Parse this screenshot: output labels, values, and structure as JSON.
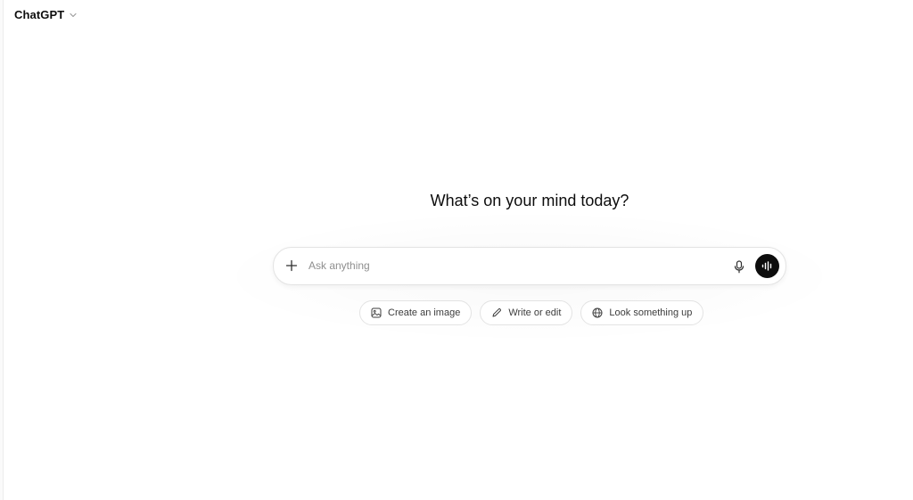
{
  "header": {
    "model_name": "ChatGPT",
    "chevron_icon": "chevron-down-icon"
  },
  "main": {
    "heading": "What’s on your mind today?"
  },
  "composer": {
    "placeholder": "Ask anything",
    "value": "",
    "plus_icon": "plus-icon",
    "mic_icon": "microphone-icon",
    "voice_icon": "voice-waveform-icon",
    "voice_button_color": "#0d0d0d"
  },
  "suggestions": [
    {
      "label": "Create an image",
      "icon": "image-icon"
    },
    {
      "label": "Write or edit",
      "icon": "pencil-icon"
    },
    {
      "label": "Look something up",
      "icon": "globe-icon"
    }
  ]
}
